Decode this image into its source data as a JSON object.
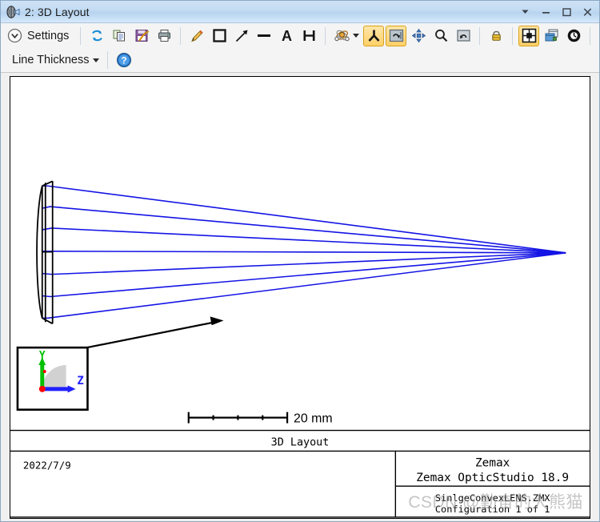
{
  "window": {
    "title": "2: 3D Layout",
    "icon": "lens-icon",
    "controls": [
      {
        "name": "window-menu-button",
        "glyph": "▼"
      },
      {
        "name": "minimize-button",
        "glyph": "—"
      },
      {
        "name": "maximize-button",
        "glyph": "▢"
      },
      {
        "name": "close-button",
        "glyph": "✕"
      }
    ]
  },
  "toolbar": {
    "settings_label": "Settings",
    "line_thickness_label": "Line Thickness",
    "row1_icons": [
      {
        "name": "refresh-icon",
        "tooltip": "Refresh"
      },
      {
        "name": "copy-icon",
        "tooltip": "Copy"
      },
      {
        "name": "save-image-icon",
        "tooltip": "Save"
      },
      {
        "name": "print-icon",
        "tooltip": "Print"
      },
      {
        "name": "pencil-annotation-icon",
        "tooltip": "Draw"
      },
      {
        "name": "rectangle-annotation-icon",
        "tooltip": "Rectangle"
      },
      {
        "name": "arrow-annotation-icon",
        "tooltip": "Arrow"
      },
      {
        "name": "line-annotation-icon",
        "tooltip": "Line"
      },
      {
        "name": "text-annotation-icon",
        "tooltip": "Text"
      },
      {
        "name": "dimension-annotation-icon",
        "tooltip": "Dimension"
      },
      {
        "name": "rotate-3d-icon",
        "tooltip": "Rotate"
      },
      {
        "name": "axis-tripod-icon",
        "tooltip": "Axes"
      },
      {
        "name": "rotate-view-icon",
        "tooltip": "Rotate View"
      },
      {
        "name": "pan-icon",
        "tooltip": "Pan"
      },
      {
        "name": "zoom-icon",
        "tooltip": "Zoom"
      },
      {
        "name": "zoom-reset-icon",
        "tooltip": "Reset Zoom"
      },
      {
        "name": "lock-icon",
        "tooltip": "Lock"
      },
      {
        "name": "fit-window-icon",
        "tooltip": "Fit to Window"
      },
      {
        "name": "clone-window-icon",
        "tooltip": "Clone Window"
      },
      {
        "name": "clock-icon",
        "tooltip": "Timer"
      }
    ],
    "help_icon": "help-icon",
    "active_icons": [
      "axis-tripod-icon",
      "rotate-view-icon",
      "fit-window-icon"
    ]
  },
  "plot": {
    "footer_title": "3D Layout",
    "scale_label": "20 mm",
    "date": "2022/7/9",
    "vendor": "Zemax",
    "product": "Zemax OpticStudio 18.9",
    "file_name": "SinlgeConvexLENS.ZMX",
    "configuration": "Configuration 1 of 1",
    "axis_labels": {
      "vertical": "Y",
      "horizontal": "Z"
    },
    "colors": {
      "ray": "#1414e6",
      "lens_outline": "#000000",
      "axis_y": "#00c000",
      "axis_z": "#2020ff",
      "axis_x": "#ff0000"
    },
    "ray_count": 7,
    "watermark": "CSDN @勤奋的大熊猫"
  }
}
